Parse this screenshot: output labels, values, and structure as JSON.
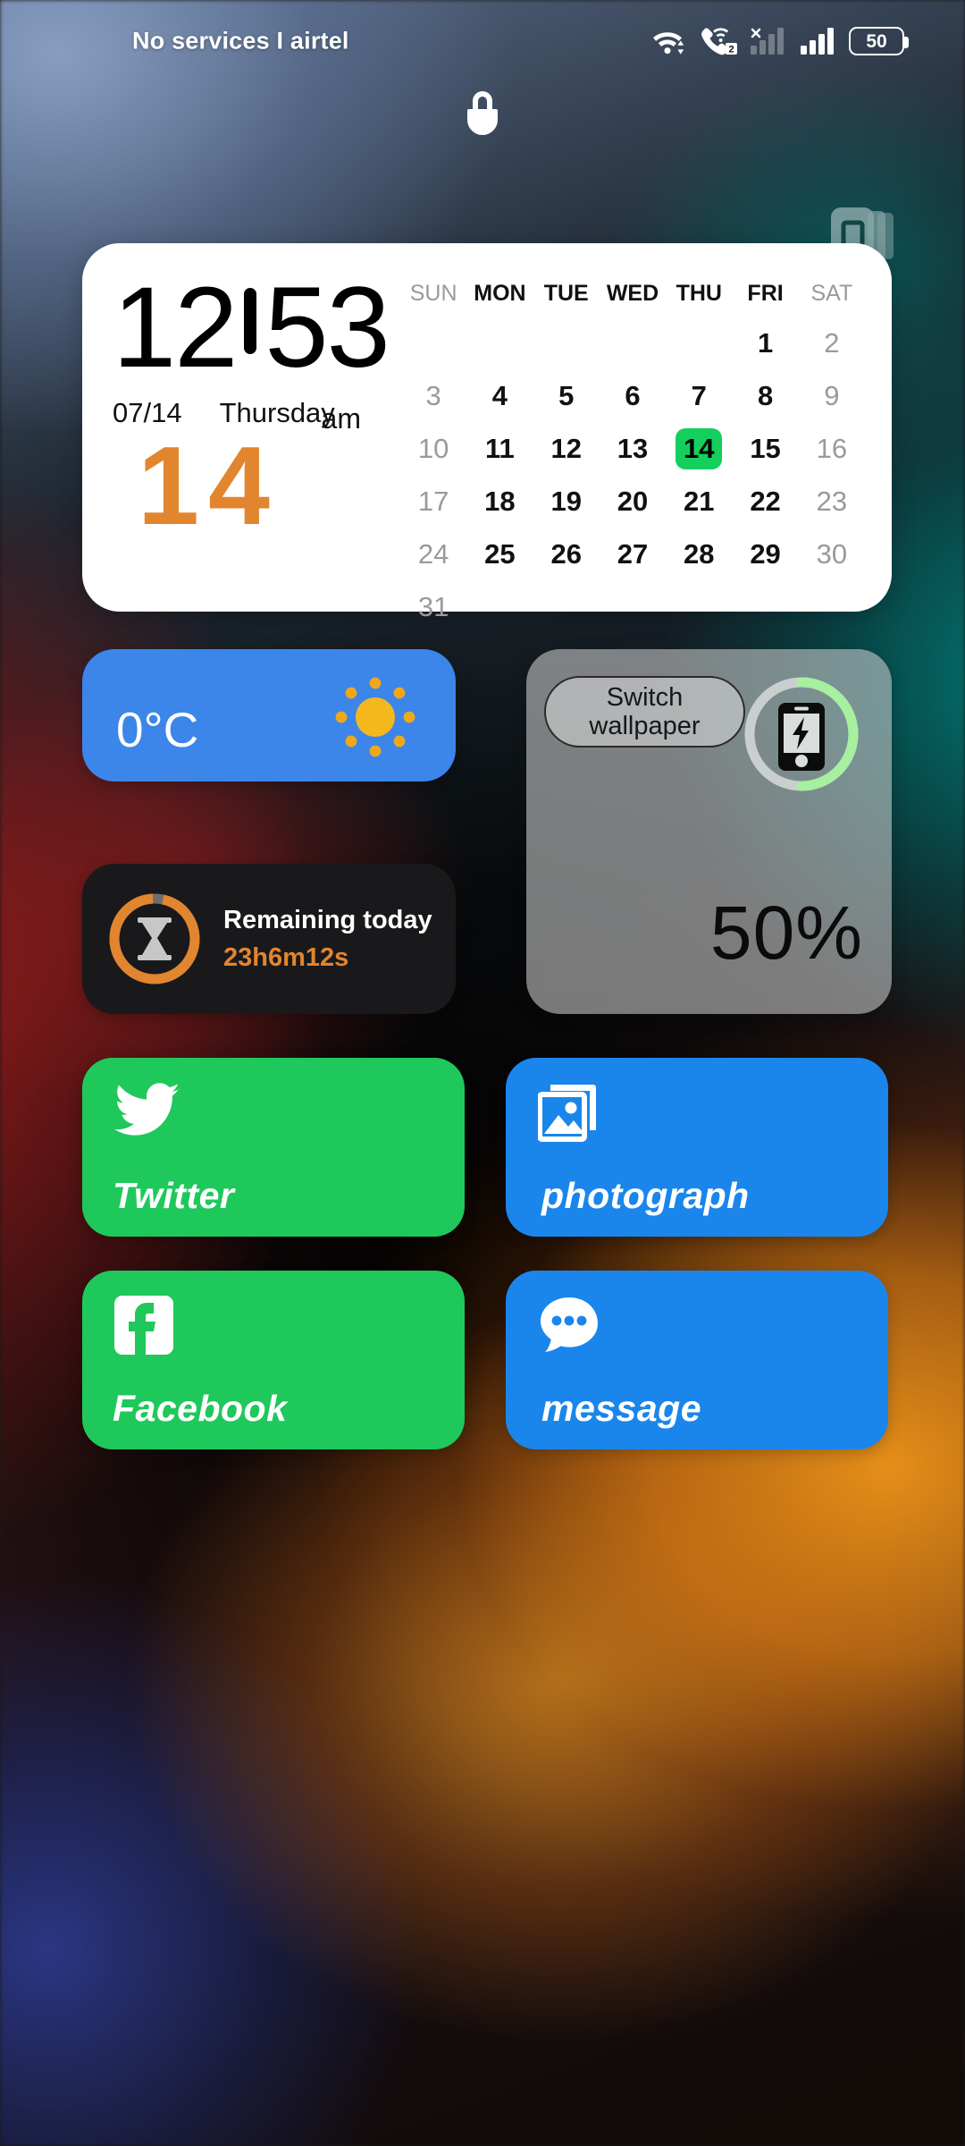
{
  "status_bar": {
    "carrier_text": "No services I airtel",
    "icons": [
      {
        "name": "wifi-icon",
        "label": "wifi"
      },
      {
        "name": "vowifi-call-icon",
        "label": "call-wifi-sim2",
        "badge": "2"
      },
      {
        "name": "signal-no-service-icon",
        "label": "signal-sim1-no-service",
        "mark": "×"
      },
      {
        "name": "signal-bars-icon",
        "label": "signal-sim2"
      },
      {
        "name": "battery-icon",
        "label": "battery"
      }
    ],
    "battery_level": "50"
  },
  "lock": {
    "icon": "lock-icon"
  },
  "widget_pages": {
    "icon": "card-stack-icon"
  },
  "clock_card": {
    "hours": "12",
    "minutes": "53",
    "date": "07/14",
    "weekday": "Thursday",
    "meridiem": "am",
    "day_number": "14",
    "accent_color": "#e2852f"
  },
  "calendar": {
    "day_headers": [
      "SUN",
      "MON",
      "TUE",
      "WED",
      "THU",
      "FRI",
      "SAT"
    ],
    "weekend_indices": [
      0,
      6
    ],
    "leading_blanks": 5,
    "days": [
      1,
      2,
      3,
      4,
      5,
      6,
      7,
      8,
      9,
      10,
      11,
      12,
      13,
      14,
      15,
      16,
      17,
      18,
      19,
      20,
      21,
      22,
      23,
      24,
      25,
      26,
      27,
      28,
      29,
      30,
      31
    ],
    "today": 14,
    "today_highlight_color": "#14cf5e"
  },
  "weather_widget": {
    "temperature": "0°C",
    "icon": "sun-icon",
    "background_color": "#3b86e8"
  },
  "battery_widget": {
    "switch_wallpaper_label": "Switch\nwallpaper",
    "switch_wallpaper_line1": "Switch",
    "switch_wallpaper_line2": "wallpaper",
    "percent_text": "50%",
    "ring_percent": 50,
    "ring_color": "#a6f0a0",
    "icon": "phone-charging-icon"
  },
  "countdown_widget": {
    "title": "Remaining today",
    "value": "23h6m12s",
    "icon": "hourglass-icon",
    "ring_percent": 96,
    "ring_color": "#e2852f",
    "background_color": "#19191b"
  },
  "app_tiles": [
    {
      "id": "twitter",
      "label": "Twitter",
      "icon": "twitter-bird-icon",
      "color": "#1fc85b"
    },
    {
      "id": "photograph",
      "label": "photograph",
      "icon": "photo-stack-icon",
      "color": "#1a86ec"
    },
    {
      "id": "facebook",
      "label": "Facebook",
      "icon": "facebook-f-icon",
      "color": "#1fc85b"
    },
    {
      "id": "message",
      "label": "message",
      "icon": "chat-bubble-icon",
      "color": "#1a86ec"
    }
  ]
}
